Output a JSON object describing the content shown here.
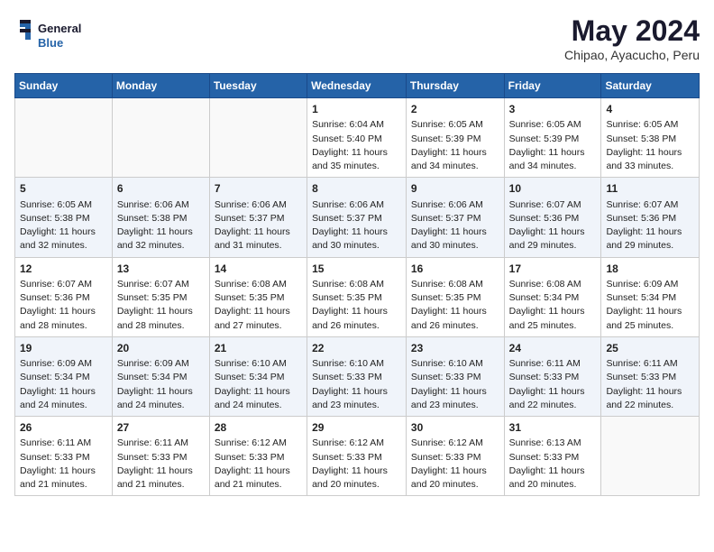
{
  "header": {
    "logo_general": "General",
    "logo_blue": "Blue",
    "month": "May 2024",
    "location": "Chipao, Ayacucho, Peru"
  },
  "days_of_week": [
    "Sunday",
    "Monday",
    "Tuesday",
    "Wednesday",
    "Thursday",
    "Friday",
    "Saturday"
  ],
  "weeks": [
    [
      {
        "day": "",
        "info": ""
      },
      {
        "day": "",
        "info": ""
      },
      {
        "day": "",
        "info": ""
      },
      {
        "day": "1",
        "info": "Sunrise: 6:04 AM\nSunset: 5:40 PM\nDaylight: 11 hours and 35 minutes."
      },
      {
        "day": "2",
        "info": "Sunrise: 6:05 AM\nSunset: 5:39 PM\nDaylight: 11 hours and 34 minutes."
      },
      {
        "day": "3",
        "info": "Sunrise: 6:05 AM\nSunset: 5:39 PM\nDaylight: 11 hours and 34 minutes."
      },
      {
        "day": "4",
        "info": "Sunrise: 6:05 AM\nSunset: 5:38 PM\nDaylight: 11 hours and 33 minutes."
      }
    ],
    [
      {
        "day": "5",
        "info": "Sunrise: 6:05 AM\nSunset: 5:38 PM\nDaylight: 11 hours and 32 minutes."
      },
      {
        "day": "6",
        "info": "Sunrise: 6:06 AM\nSunset: 5:38 PM\nDaylight: 11 hours and 32 minutes."
      },
      {
        "day": "7",
        "info": "Sunrise: 6:06 AM\nSunset: 5:37 PM\nDaylight: 11 hours and 31 minutes."
      },
      {
        "day": "8",
        "info": "Sunrise: 6:06 AM\nSunset: 5:37 PM\nDaylight: 11 hours and 30 minutes."
      },
      {
        "day": "9",
        "info": "Sunrise: 6:06 AM\nSunset: 5:37 PM\nDaylight: 11 hours and 30 minutes."
      },
      {
        "day": "10",
        "info": "Sunrise: 6:07 AM\nSunset: 5:36 PM\nDaylight: 11 hours and 29 minutes."
      },
      {
        "day": "11",
        "info": "Sunrise: 6:07 AM\nSunset: 5:36 PM\nDaylight: 11 hours and 29 minutes."
      }
    ],
    [
      {
        "day": "12",
        "info": "Sunrise: 6:07 AM\nSunset: 5:36 PM\nDaylight: 11 hours and 28 minutes."
      },
      {
        "day": "13",
        "info": "Sunrise: 6:07 AM\nSunset: 5:35 PM\nDaylight: 11 hours and 28 minutes."
      },
      {
        "day": "14",
        "info": "Sunrise: 6:08 AM\nSunset: 5:35 PM\nDaylight: 11 hours and 27 minutes."
      },
      {
        "day": "15",
        "info": "Sunrise: 6:08 AM\nSunset: 5:35 PM\nDaylight: 11 hours and 26 minutes."
      },
      {
        "day": "16",
        "info": "Sunrise: 6:08 AM\nSunset: 5:35 PM\nDaylight: 11 hours and 26 minutes."
      },
      {
        "day": "17",
        "info": "Sunrise: 6:08 AM\nSunset: 5:34 PM\nDaylight: 11 hours and 25 minutes."
      },
      {
        "day": "18",
        "info": "Sunrise: 6:09 AM\nSunset: 5:34 PM\nDaylight: 11 hours and 25 minutes."
      }
    ],
    [
      {
        "day": "19",
        "info": "Sunrise: 6:09 AM\nSunset: 5:34 PM\nDaylight: 11 hours and 24 minutes."
      },
      {
        "day": "20",
        "info": "Sunrise: 6:09 AM\nSunset: 5:34 PM\nDaylight: 11 hours and 24 minutes."
      },
      {
        "day": "21",
        "info": "Sunrise: 6:10 AM\nSunset: 5:34 PM\nDaylight: 11 hours and 24 minutes."
      },
      {
        "day": "22",
        "info": "Sunrise: 6:10 AM\nSunset: 5:33 PM\nDaylight: 11 hours and 23 minutes."
      },
      {
        "day": "23",
        "info": "Sunrise: 6:10 AM\nSunset: 5:33 PM\nDaylight: 11 hours and 23 minutes."
      },
      {
        "day": "24",
        "info": "Sunrise: 6:11 AM\nSunset: 5:33 PM\nDaylight: 11 hours and 22 minutes."
      },
      {
        "day": "25",
        "info": "Sunrise: 6:11 AM\nSunset: 5:33 PM\nDaylight: 11 hours and 22 minutes."
      }
    ],
    [
      {
        "day": "26",
        "info": "Sunrise: 6:11 AM\nSunset: 5:33 PM\nDaylight: 11 hours and 21 minutes."
      },
      {
        "day": "27",
        "info": "Sunrise: 6:11 AM\nSunset: 5:33 PM\nDaylight: 11 hours and 21 minutes."
      },
      {
        "day": "28",
        "info": "Sunrise: 6:12 AM\nSunset: 5:33 PM\nDaylight: 11 hours and 21 minutes."
      },
      {
        "day": "29",
        "info": "Sunrise: 6:12 AM\nSunset: 5:33 PM\nDaylight: 11 hours and 20 minutes."
      },
      {
        "day": "30",
        "info": "Sunrise: 6:12 AM\nSunset: 5:33 PM\nDaylight: 11 hours and 20 minutes."
      },
      {
        "day": "31",
        "info": "Sunrise: 6:13 AM\nSunset: 5:33 PM\nDaylight: 11 hours and 20 minutes."
      },
      {
        "day": "",
        "info": ""
      }
    ]
  ]
}
